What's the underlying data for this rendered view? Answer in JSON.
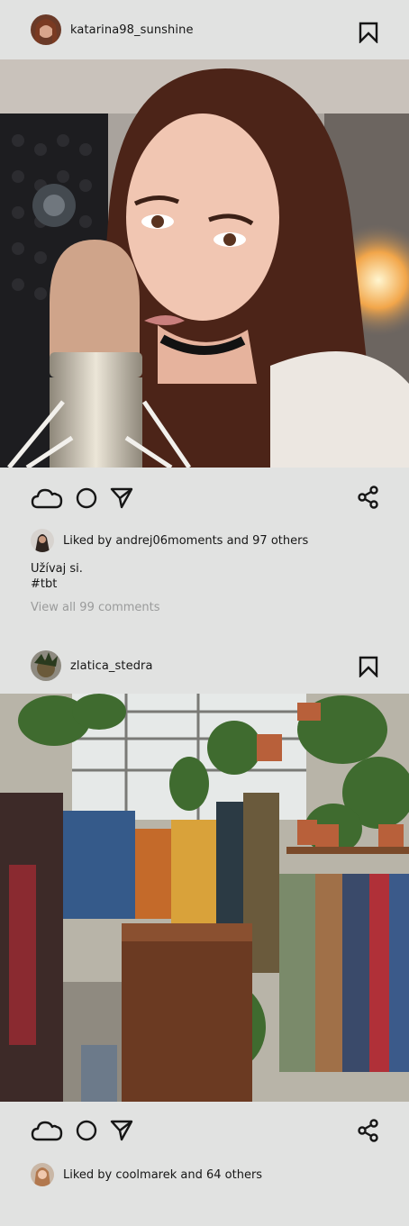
{
  "posts": [
    {
      "username": "katarina98_sunshine",
      "likes_text": "Liked by andrej06moments and 97 others",
      "caption_line1": "Užívaj si.",
      "caption_line2": "#tbt",
      "view_comments": "View all 99 comments"
    },
    {
      "username": "zlatica_stedra",
      "likes_text": "Liked by coolmarek and 64 others"
    }
  ],
  "icons": {
    "like": "cloud-like-icon",
    "comment": "circle-comment-icon",
    "send": "send-arrow-icon",
    "share": "share-icon",
    "save": "bookmark-icon"
  }
}
